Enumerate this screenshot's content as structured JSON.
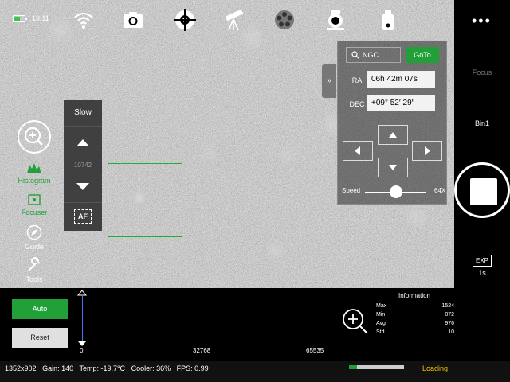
{
  "status": {
    "time": "19:11",
    "battery_level": 0.6
  },
  "top_icons": [
    "wifi-icon",
    "camera-icon",
    "crosshair-icon",
    "telescope-icon",
    "filter-wheel-icon",
    "focuser-icon",
    "usb-drive-icon"
  ],
  "left_tools": [
    {
      "label": "Histogram",
      "active": true
    },
    {
      "label": "Focuser",
      "active": true
    },
    {
      "label": "Guide",
      "active": false
    },
    {
      "label": "Tools",
      "active": false
    }
  ],
  "speed_panel": {
    "label": "Slow",
    "value": "10742",
    "af_label": "AF"
  },
  "goto": {
    "search_text": "NGC...",
    "goto_label": "GoTo",
    "ra_label": "RA",
    "ra_value": "06h 42m 07s",
    "dec_label": "DEC",
    "dec_value": "+09° 52′ 29″",
    "speed_label": "Speed",
    "speed_max": "64X",
    "speed_level": 0.5,
    "collapse_label": "»"
  },
  "right_panel": {
    "focus_label": "Focus",
    "bin_label": "Bin1",
    "exp_label": "EXP",
    "exp_value": "1s"
  },
  "histogram": {
    "auto_label": "Auto",
    "reset_label": "Reset",
    "ticks": [
      "0",
      "32768",
      "65535"
    ]
  },
  "information": {
    "title": "Information",
    "rows": [
      {
        "k": "Max",
        "v": "1524"
      },
      {
        "k": "Min",
        "v": "872"
      },
      {
        "k": "Avg",
        "v": "976"
      },
      {
        "k": "Std",
        "v": "10"
      }
    ]
  },
  "statusbar": {
    "resolution": "1352x902",
    "gain": "Gain: 140",
    "temp": "Temp: -19.7°C",
    "cooler": "Cooler: 36%",
    "fps": "FPS: 0.99",
    "progress": 0.15,
    "loading": "Loading"
  },
  "colors": {
    "accent": "#21a03a",
    "loading": "#f2c200",
    "histogram_line": "#4a6cff"
  }
}
